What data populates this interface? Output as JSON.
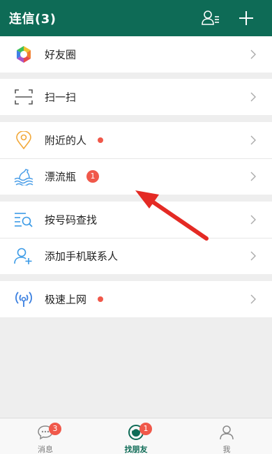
{
  "colors": {
    "header": "#0e6b56",
    "accent": "#0e6b56",
    "badge": "#f0584a",
    "arrow": "#e42a24"
  },
  "header": {
    "title": "连信(3)",
    "contacts_icon": "contacts-list-icon",
    "add_icon": "plus-icon"
  },
  "menu": {
    "moments": {
      "label": "好友圈",
      "icon": "moments-colorful-icon"
    },
    "scan": {
      "label": "扫一扫",
      "icon": "scan-icon"
    },
    "nearby": {
      "label": "附近的人",
      "icon": "location-pin-icon",
      "has_dot": true
    },
    "bottle": {
      "label": "漂流瓶",
      "icon": "drift-bottle-icon",
      "badge": "1"
    },
    "find_by_number": {
      "label": "按号码查找",
      "icon": "search-list-icon"
    },
    "add_contacts": {
      "label": "添加手机联系人",
      "icon": "add-person-icon"
    },
    "fast_internet": {
      "label": "极速上网",
      "icon": "wifi-signal-icon",
      "has_dot": true
    }
  },
  "tabs": [
    {
      "label": "消息",
      "icon": "chat-bubble-icon",
      "badge": "3",
      "active": false
    },
    {
      "label": "找朋友",
      "icon": "find-friends-icon",
      "badge": "1",
      "active": true
    },
    {
      "label": "我",
      "icon": "person-icon",
      "badge": "",
      "active": false
    }
  ]
}
